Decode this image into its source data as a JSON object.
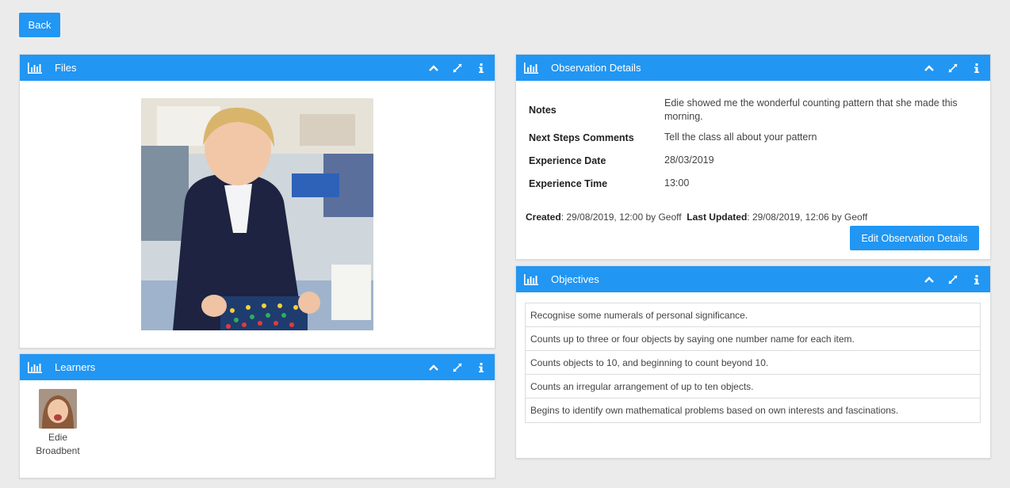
{
  "toolbar": {
    "back_label": "Back"
  },
  "files": {
    "title": "Files"
  },
  "learners": {
    "title": "Learners",
    "items": [
      {
        "first_name": "Edie",
        "last_name": "Broadbent"
      }
    ]
  },
  "observation": {
    "title": "Observation Details",
    "rows": [
      {
        "label": "Notes",
        "value": "Edie showed me the wonderful counting pattern that she made this morning."
      },
      {
        "label": "Next Steps Comments",
        "value": "Tell the class all about your pattern"
      },
      {
        "label": "Experience Date",
        "value": "28/03/2019"
      },
      {
        "label": "Experience Time",
        "value": "13:00"
      }
    ],
    "created_label": "Created",
    "created_value": ": 29/08/2019, 12:00 by Geoff",
    "updated_label": "Last Updated",
    "updated_value": ": 29/08/2019, 12:06 by Geoff",
    "edit_label": "Edit Observation Details"
  },
  "objectives": {
    "title": "Objectives",
    "items": [
      "Recognise some numerals of personal significance.",
      "Counts up to three or four objects by saying one number name for each item.",
      "Counts objects to 10, and beginning to count beyond 10.",
      "Counts an irregular arrangement of up to ten objects.",
      "Begins to identify own mathematical problems based on own interests and fascinations."
    ]
  },
  "icons": {
    "panel": "bar-chart-icon",
    "collapse": "chevron-up-icon",
    "expand": "expand-icon",
    "info": "info-icon"
  },
  "colors": {
    "accent": "#2196f3",
    "background": "#ecebeb"
  }
}
